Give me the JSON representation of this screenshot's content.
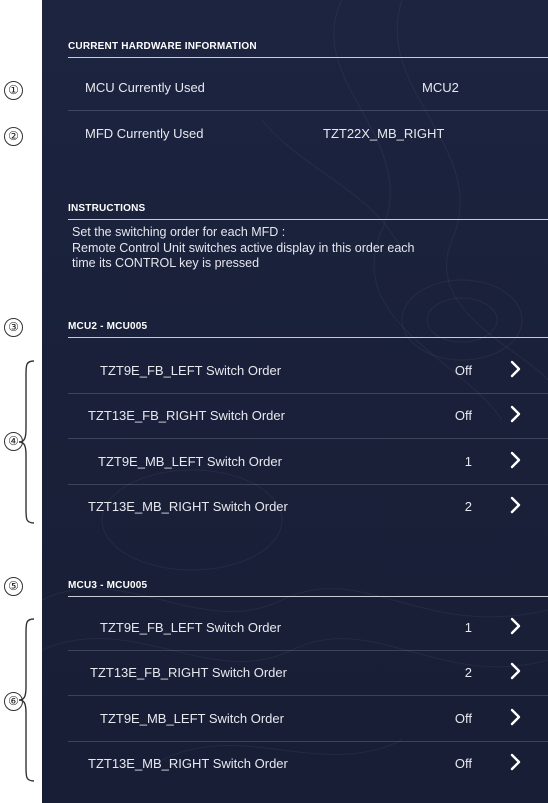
{
  "hardware": {
    "header": "CURRENT HARDWARE INFORMATION",
    "mcu_label": "MCU Currently Used",
    "mcu_value": "MCU2",
    "mfd_label": "MFD Currently Used",
    "mfd_value": "TZT22X_MB_RIGHT"
  },
  "instructions": {
    "header": "INSTRUCTIONS",
    "lines": [
      "Set the switching order for each MFD :",
      "Remote Control Unit switches active display in this order each",
      "time its CONTROL key is pressed"
    ]
  },
  "groups": [
    {
      "header": "MCU2 - MCU005",
      "rows": [
        {
          "label": "TZT9E_FB_LEFT Switch Order",
          "value": "Off"
        },
        {
          "label": "TZT13E_FB_RIGHT Switch Order",
          "value": "Off"
        },
        {
          "label": "TZT9E_MB_LEFT Switch Order",
          "value": "1"
        },
        {
          "label": "TZT13E_MB_RIGHT Switch Order",
          "value": "2"
        }
      ]
    },
    {
      "header": "MCU3 - MCU005",
      "rows": [
        {
          "label": "TZT9E_FB_LEFT Switch Order",
          "value": "1"
        },
        {
          "label": "TZT13E_FB_RIGHT Switch Order",
          "value": "2"
        },
        {
          "label": "TZT9E_MB_LEFT Switch Order",
          "value": "Off"
        },
        {
          "label": "TZT13E_MB_RIGHT Switch Order",
          "value": "Off"
        }
      ]
    }
  ],
  "callouts": [
    "①",
    "②",
    "③",
    "④",
    "⑤",
    "⑥"
  ],
  "icons": {
    "row_chevron": "chevron-right-icon",
    "callout_brace": "curly-brace-icon"
  },
  "colors": {
    "panel_bg": "#1b223c",
    "text": "#e8e9ef",
    "divider": "#c9ccd6"
  }
}
